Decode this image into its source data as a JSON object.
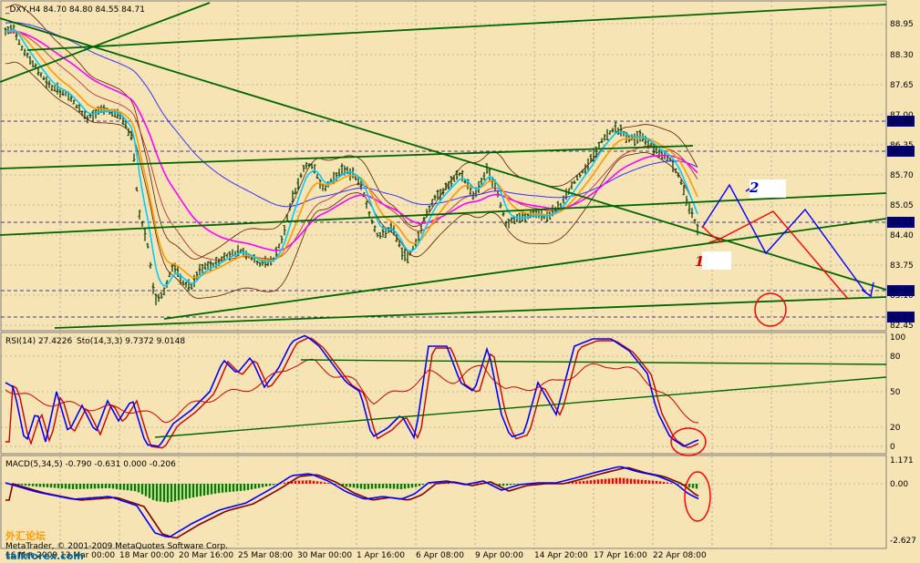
{
  "header": {
    "main": "_DXY,H4  84.70 84.80 84.55 84.71",
    "rsi": "RSI(14) 27.4226",
    "sto": "Sto(14,3,3) 9.7372 9.0148",
    "macd": "MACD(5,34,5) -0.790 -0.631 0.000 -0.206"
  },
  "price_axis": [
    "88.95",
    "88.30",
    "87.65",
    "87.00",
    "86.35",
    "85.70",
    "85.05",
    "84.40",
    "83.75",
    "83.10",
    "82.45"
  ],
  "price_boxes": [
    {
      "label": "86.86"
    },
    {
      "label": "86.20"
    },
    {
      "label": "84.71"
    },
    {
      "label": "83.20"
    },
    {
      "label": "82.63"
    }
  ],
  "osc_axis": [
    "100",
    "80",
    "50",
    "20",
    "0"
  ],
  "macd_axis": [
    "1.171",
    "0.00",
    "-2.627"
  ],
  "time_axis": [
    "16 Mar 2009",
    "13 Mar 00:00",
    "18 Mar 00:00",
    "20 Mar 16:00",
    "25 Mar 08:00",
    "30 Mar 00:00",
    "1 Apr 16:00",
    "6 Apr 08:00",
    "9 Apr 00:00",
    "14 Apr 20:00",
    "17 Apr 16:00",
    "22 Apr 08:00"
  ],
  "annotations": {
    "one": "1",
    "two": "2"
  },
  "watermark": {
    "cn": "外汇论坛",
    "site": "talkforex.com",
    "copyright": "MetaTrader, © 2001-2009 MetaQuotes Software Corp."
  },
  "colors": {
    "background": "#f7e4b5",
    "price_bars": "#003300",
    "ema_cyan": "#00ccff",
    "ema_orange": "#ff9900",
    "ema_magenta": "#ff00ff",
    "ema_blue": "#3333ff",
    "trendline": "#006600",
    "forecast_red": "#ff0000",
    "forecast_blue": "#0000ff",
    "rsi": "#cc0000",
    "sto_main": "#0000ff",
    "macd_main": "#0000ff",
    "macd_signal": "#800000",
    "hist_pos": "#ff0000",
    "hist_neg": "#008000"
  }
}
